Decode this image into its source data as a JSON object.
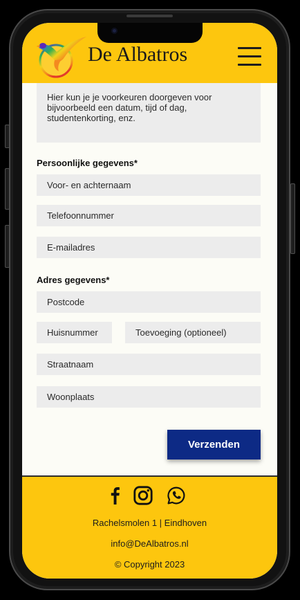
{
  "header": {
    "brand_name": "De Albatros",
    "logo_icon": "albatross-logo-icon",
    "menu_icon": "hamburger-menu-icon"
  },
  "form": {
    "preferences_placeholder": "Hier kun je je voorkeuren doorgeven voor bijvoorbeeld een datum, tijd of dag, studentenkorting, enz.",
    "personal_heading": "Persoonlijke gegevens*",
    "personal_fields": [
      "Voor- en achternaam",
      "Telefoonnummer",
      "E-mailadres"
    ],
    "address_heading": "Adres gegevens*",
    "address_fields": {
      "postcode": "Postcode",
      "huisnummer": "Huisnummer",
      "toevoeging": "Toevoeging (optioneel)",
      "straatnaam": "Straatnaam",
      "woonplaats": "Woonplaats"
    },
    "submit_label": "Verzenden"
  },
  "footer": {
    "social_icons": [
      "facebook-icon",
      "instagram-icon",
      "whatsapp-icon"
    ],
    "address": "Rachelsmolen 1 | Eindhoven",
    "email": "info@DeAlbatros.nl",
    "copyright": "© Copyright 2023"
  },
  "colors": {
    "brand_yellow": "#fdc60e",
    "button_blue": "#0d2a85",
    "field_gray": "#ececec",
    "page_bg": "#fcfcf6"
  }
}
